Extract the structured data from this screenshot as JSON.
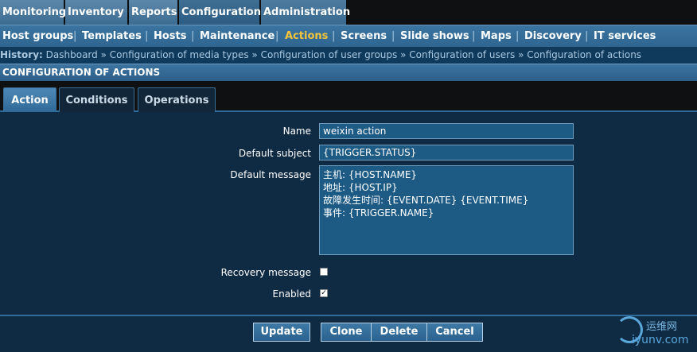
{
  "topnav": {
    "tabs": [
      {
        "label": "Monitoring"
      },
      {
        "label": "Inventory"
      },
      {
        "label": "Reports"
      },
      {
        "label": "Configuration"
      },
      {
        "label": "Administration"
      }
    ]
  },
  "subnav": {
    "items": [
      "Host groups",
      "Templates",
      "Hosts",
      "Maintenance",
      "Actions",
      "Screens",
      "Slide shows",
      "Maps",
      "Discovery",
      "IT services"
    ],
    "separator": "|"
  },
  "history": {
    "label": "History:",
    "links": [
      "Dashboard",
      "Configuration of media types",
      "Configuration of user groups",
      "Configuration of users",
      "Configuration of actions"
    ],
    "separator": "»"
  },
  "section": {
    "title": "CONFIGURATION OF ACTIONS"
  },
  "tabs": {
    "action": "Action",
    "conditions": "Conditions",
    "operations": "Operations"
  },
  "form": {
    "name_label": "Name",
    "name_value": "weixin action",
    "subject_label": "Default subject",
    "subject_value": "{TRIGGER.STATUS}",
    "message_label": "Default message",
    "message_value": "主机: {HOST.NAME}\n地址: {HOST.IP}\n故障发生时间: {EVENT.DATE} {EVENT.TIME}\n事件: {TRIGGER.NAME}",
    "recovery_label": "Recovery message",
    "enabled_label": "Enabled",
    "check_mark": "✓"
  },
  "buttons": {
    "update": "Update",
    "clone": "Clone",
    "delete": "Delete",
    "cancel": "Cancel"
  },
  "watermark": {
    "cn": "运维网",
    "en": "iyunv.com"
  }
}
